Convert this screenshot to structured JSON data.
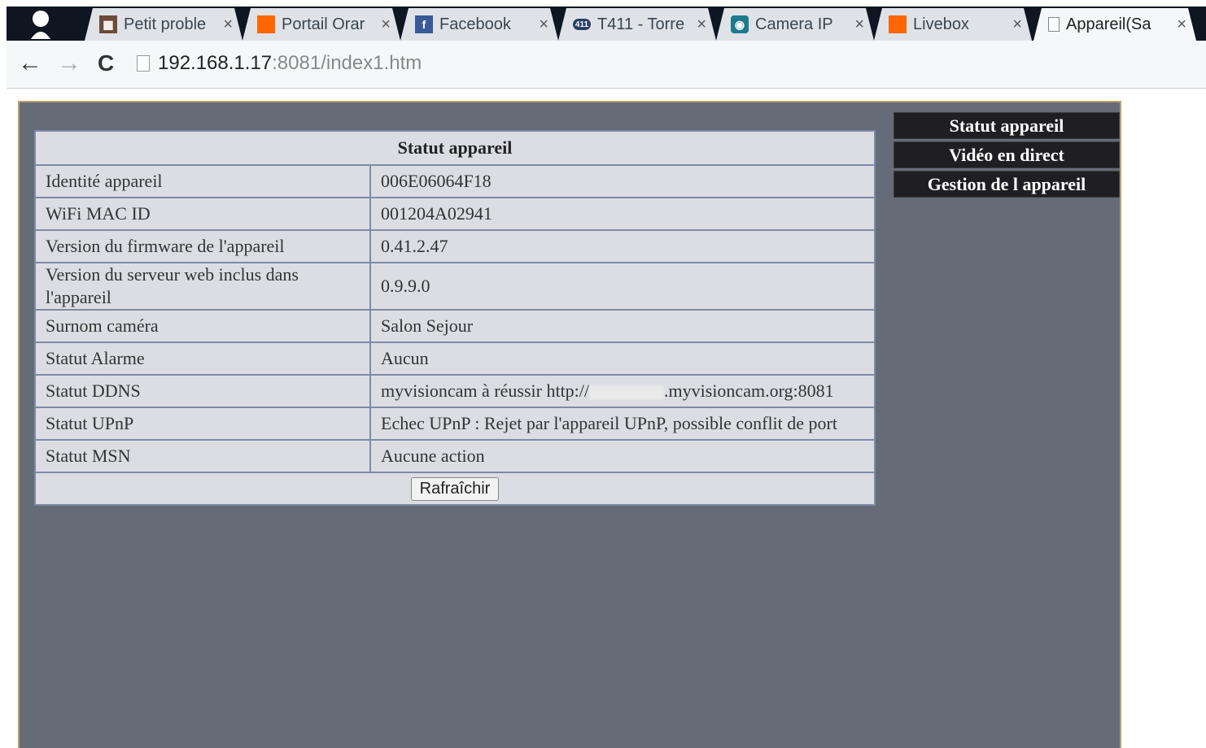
{
  "browser": {
    "tabs": [
      {
        "label": "Petit proble",
        "icon": "forum-favicon-icon",
        "color": "#6b4b3a"
      },
      {
        "label": "Portail Orar",
        "icon": "orange-favicon-icon",
        "color": "#ff6600"
      },
      {
        "label": "Facebook",
        "icon": "facebook-favicon-icon",
        "color": "#3b5998"
      },
      {
        "label": "T411 - Torre",
        "icon": "t411-favicon-icon",
        "color": "#2a3f66"
      },
      {
        "label": "Camera IP",
        "icon": "camera-favicon-icon",
        "color": "#1e7a8c"
      },
      {
        "label": "Livebox",
        "icon": "orange-favicon-icon",
        "color": "#ff6600"
      },
      {
        "label": "Appareil(Sa",
        "icon": "page-icon",
        "color": "#ffffff",
        "active": true
      }
    ],
    "close_glyph": "×",
    "address": {
      "host": "192.168.1.17",
      "rest": ":8081/index1.htm"
    }
  },
  "status": {
    "title": "Statut appareil",
    "rows": [
      {
        "label": "Identité appareil",
        "value": "006E06064F18"
      },
      {
        "label": "WiFi MAC ID",
        "value": "001204A02941"
      },
      {
        "label": "Version du firmware de l'appareil",
        "value": "0.41.2.47"
      },
      {
        "label": "Version du serveur web inclus dans l'appareil",
        "value": "0.9.9.0"
      },
      {
        "label": "Surnom caméra",
        "value": "Salon Sejour"
      },
      {
        "label": "Statut Alarme",
        "value": "Aucun"
      },
      {
        "label": "Statut DDNS",
        "value_prefix": "myvisioncam à réussir  http://",
        "value_suffix": ".myvisioncam.org:8081"
      },
      {
        "label": "Statut UPnP",
        "value": "Echec UPnP : Rejet par l'appareil UPnP, possible conflit de port"
      },
      {
        "label": "Statut MSN",
        "value": "Aucune action"
      }
    ],
    "refresh_label": "Rafraîchir"
  },
  "menu": {
    "items": [
      "Statut appareil",
      "Vidéo en direct",
      "Gestion de l appareil"
    ]
  }
}
